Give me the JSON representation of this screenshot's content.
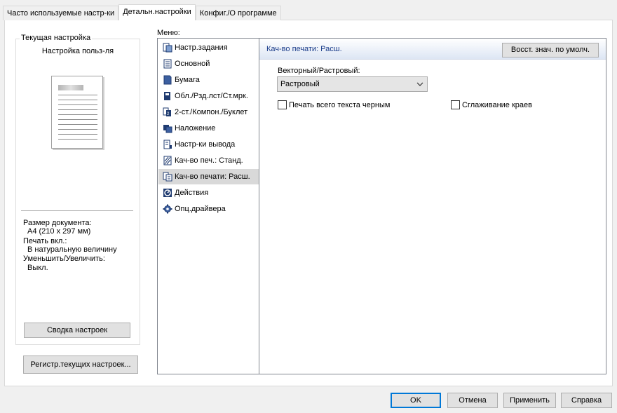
{
  "tabs": [
    {
      "label": "Часто используемые настр-ки",
      "active": false
    },
    {
      "label": "Детальн.настройки",
      "active": true
    },
    {
      "label": "Конфиг./О программе",
      "active": false
    }
  ],
  "current_settings": {
    "group_label": "Текущая настройка",
    "preset_name": "Настройка польз-ля",
    "doc_size_label": "Размер документа:",
    "doc_size_value": "A4 (210 x 297 мм)",
    "print_on_label": "Печать вкл.:",
    "print_on_value": "В натуральную величину",
    "zoom_label": "Уменьшить/Увеличить:",
    "zoom_value": "Выкл.",
    "summary_button": "Сводка настроек",
    "register_button": "Регистр.текущих настроек..."
  },
  "menu": {
    "label": "Меню:",
    "items": [
      {
        "label": "Настр.задания",
        "icon": "job-settings-icon"
      },
      {
        "label": "Основной",
        "icon": "basic-icon"
      },
      {
        "label": "Бумага",
        "icon": "paper-icon"
      },
      {
        "label": "Обл./Рзд.лст/Ст.мрк.",
        "icon": "cover-icon"
      },
      {
        "label": "2-ст./Компон./Буклет",
        "icon": "duplex-icon"
      },
      {
        "label": "Наложение",
        "icon": "overlay-icon"
      },
      {
        "label": "Настр-ки вывода",
        "icon": "output-icon"
      },
      {
        "label": "Кач-во печ.: Станд.",
        "icon": "quality-standard-icon"
      },
      {
        "label": "Кач-во печати: Расш.",
        "icon": "quality-advanced-icon",
        "selected": true
      },
      {
        "label": "Действия",
        "icon": "actions-icon"
      },
      {
        "label": "Опц.драйвера",
        "icon": "driver-options-icon"
      }
    ]
  },
  "panel": {
    "title": "Кач-во печати: Расш.",
    "restore_button": "Восст. знач. по умолч.",
    "vector_raster_label": "Векторный/Растровый:",
    "vector_raster_value": "Растровый",
    "print_text_black_label": "Печать всего текста черным",
    "print_text_black_checked": false,
    "smoothing_label": "Сглаживание краев",
    "smoothing_checked": false
  },
  "footer": {
    "ok": "OK",
    "cancel": "Отмена",
    "apply": "Применить",
    "help": "Справка"
  },
  "colors": {
    "accent": "#0078d7",
    "header_text": "#1a3c8a",
    "selection": "#d9d9d9"
  }
}
